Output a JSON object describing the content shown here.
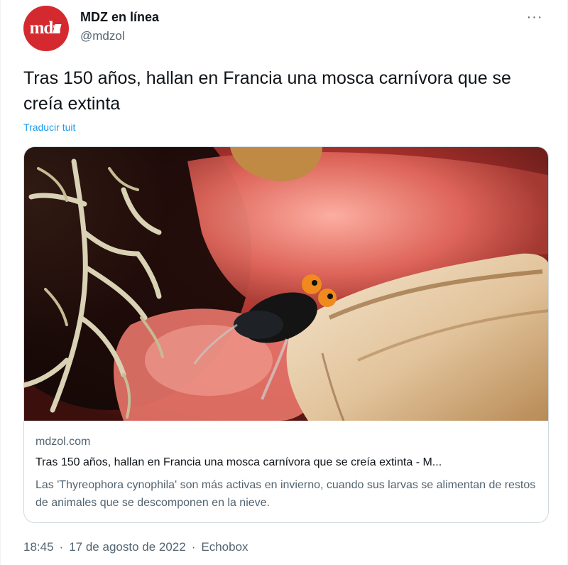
{
  "author": {
    "avatar_text": "mdz",
    "name": "MDZ en línea",
    "handle": "@mdzol"
  },
  "more_icon": "more-horizontal-icon",
  "more_label": "···",
  "tweet": {
    "text": "Tras 150 años, hallan en Francia una mosca carnívora que se creía extinta",
    "translate_label": "Traducir tuit"
  },
  "card": {
    "domain": "mdzol.com",
    "title": "Tras 150 años, hallan en Francia una mosca carnívora que se creía extinta - M...",
    "description": "Las 'Thyreophora cynophila' son más activas en invierno, cuando sus larvas se alimentan de restos de animales que se descomponen en la nieve."
  },
  "meta": {
    "time": "18:45",
    "separator": "·",
    "date": "17 de agosto de 2022",
    "source": "Echobox"
  },
  "colors": {
    "avatar": "#d42a2f",
    "link": "#1d9bf0",
    "secondary_text": "#536471",
    "border": "#cfd9de"
  }
}
